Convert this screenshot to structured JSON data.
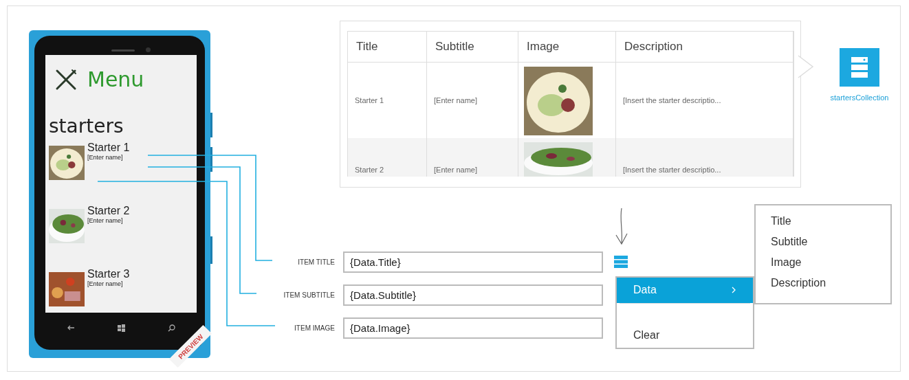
{
  "phone": {
    "app_title": "Menu",
    "section_title": "starters",
    "ribbon": "PREVIEW",
    "items": [
      {
        "title": "Starter 1",
        "subtitle": "[Enter name]"
      },
      {
        "title": "Starter 2",
        "subtitle": "[Enter name]"
      },
      {
        "title": "Starter 3",
        "subtitle": "[Enter name]"
      }
    ]
  },
  "table": {
    "columns": [
      "Title",
      "Subtitle",
      "Image",
      "Description"
    ],
    "rows": [
      {
        "title": "Starter 1",
        "subtitle": "[Enter name]",
        "description": "[Insert the starter descriptio..."
      },
      {
        "title": "Starter 2",
        "subtitle": "[Enter name]",
        "description": "[Insert the starter descriptio..."
      }
    ]
  },
  "collection": {
    "label": "startersCollection"
  },
  "bindings": [
    {
      "label": "ITEM TITLE",
      "value": "{Data.Title}"
    },
    {
      "label": "ITEM SUBTITLE",
      "value": "{Data.Subtitle}"
    },
    {
      "label": "ITEM IMAGE",
      "value": "{Data.Image}"
    }
  ],
  "context_menu": {
    "items": [
      {
        "label": "Data",
        "selected": true,
        "has_submenu": true
      },
      {
        "label": "Clear",
        "selected": false,
        "has_submenu": false
      }
    ]
  },
  "submenu": {
    "items": [
      "Title",
      "Subtitle",
      "Image",
      "Description"
    ]
  }
}
